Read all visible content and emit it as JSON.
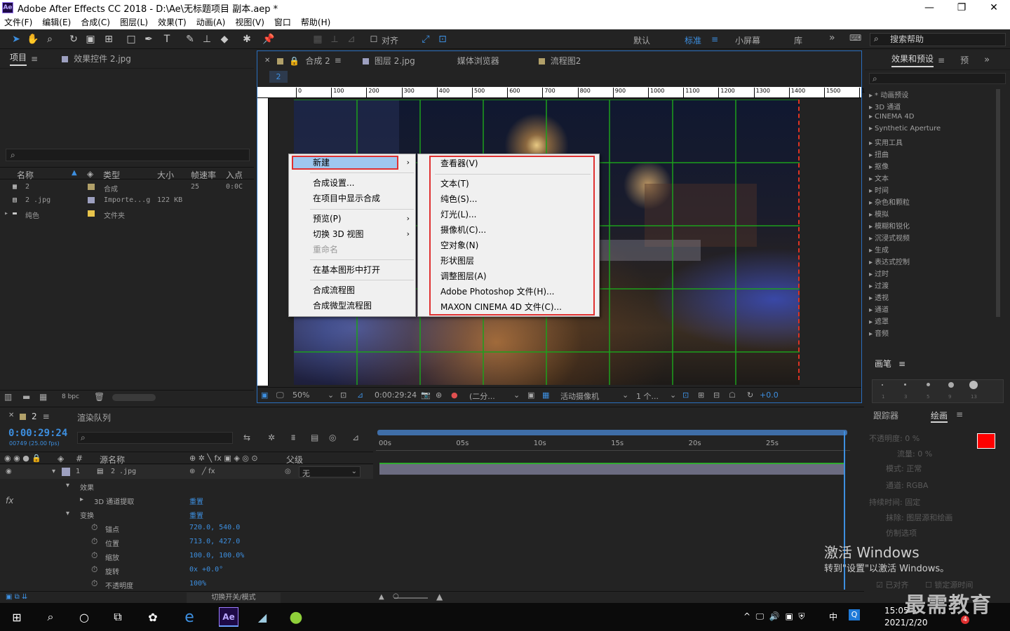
{
  "window": {
    "logo": "Ae",
    "title": "Adobe After Effects CC 2018 - D:\\Ae\\无标题项目 副本.aep *",
    "min": "—",
    "max": "❐",
    "close": "✕"
  },
  "menubar": [
    "文件(F)",
    "编辑(E)",
    "合成(C)",
    "图层(L)",
    "效果(T)",
    "动画(A)",
    "视图(V)",
    "窗口",
    "帮助(H)"
  ],
  "toolbar": {
    "align_label": "对齐",
    "workspaces": [
      "默认",
      "标准",
      "小屏幕",
      "库"
    ],
    "active_workspace": "标准",
    "more": "»",
    "search_placeholder": "搜索帮助"
  },
  "project": {
    "tabs": [
      "项目",
      "效果控件 2.jpg"
    ],
    "columns": [
      "名称",
      "类型",
      "大小",
      "帧速率",
      "入点"
    ],
    "rows": [
      {
        "name": "2",
        "type": "合成",
        "size": "",
        "fps": "25",
        "in": "0:0C",
        "color": "#b1a069"
      },
      {
        "name": "2 .jpg",
        "type": "Importe...g",
        "size": "122 KB",
        "fps": "",
        "in": "",
        "color": "#9da0c0"
      },
      {
        "name": "纯色",
        "type": "文件夹",
        "size": "",
        "fps": "",
        "in": "",
        "color": "#e8c44b"
      }
    ],
    "bpc": "8 bpc"
  },
  "comp": {
    "tabs": [
      "合成 2",
      "图层 2.jpg",
      "媒体浏览器",
      "流程图2"
    ],
    "sub_tab": "2",
    "ruler_ticks": [
      "0",
      "100",
      "200",
      "300",
      "400",
      "500",
      "600",
      "700",
      "800",
      "900",
      "1000",
      "1100",
      "1200",
      "1300",
      "1400",
      "1500",
      "16"
    ],
    "footer": {
      "zoom": "50%",
      "time": "0:00:29:24",
      "resolution": "(二分...",
      "camera": "活动摄像机",
      "views": "1 个...",
      "exposure": "+0.0"
    }
  },
  "context_menu": {
    "items": [
      {
        "label": "新建",
        "submenu": true,
        "highlight": true
      },
      {
        "label": "合成设置..."
      },
      {
        "label": "在项目中显示合成"
      },
      {
        "label": "预览(P)",
        "submenu": true
      },
      {
        "label": "切换 3D 视图",
        "submenu": true
      },
      {
        "label": "重命名",
        "disabled": true
      },
      {
        "label": "在基本图形中打开"
      },
      {
        "label": "合成流程图"
      },
      {
        "label": "合成微型流程图"
      }
    ],
    "arrow": "›"
  },
  "submenu": {
    "items": [
      "查看器(V)",
      "文本(T)",
      "纯色(S)...",
      "灯光(L)...",
      "摄像机(C)...",
      "空对象(N)",
      "形状图层",
      "调整图层(A)",
      "Adobe Photoshop 文件(H)...",
      "MAXON CINEMA 4D 文件(C)..."
    ]
  },
  "effects": {
    "tabs": [
      "效果和预设",
      "预"
    ],
    "items": [
      "* 动画预设",
      "3D 通道",
      "CINEMA 4D",
      "Synthetic Aperture",
      "实用工具",
      "扭曲",
      "抠像",
      "文本",
      "时间",
      "杂色和颗粒",
      "模拟",
      "模糊和锐化",
      "沉浸式视频",
      "生成",
      "表达式控制",
      "过时",
      "过渡",
      "透视",
      "通道",
      "遮罩",
      "音频"
    ]
  },
  "brush": {
    "tab": "画笔",
    "sizes": [
      "1",
      "3",
      "5",
      "9",
      "13"
    ]
  },
  "timeline": {
    "tabs": [
      "2",
      "渲染队列"
    ],
    "timecode": "0:00:29:24",
    "frames": "00749 (25.00 fps)",
    "columns": [
      "源名称",
      "父级"
    ],
    "ruler": [
      "00s",
      "05s",
      "10s",
      "15s",
      "20s",
      "25s"
    ],
    "layer": {
      "index": "1",
      "name": "2 .jpg",
      "parent": "无"
    },
    "props": [
      {
        "indent": 1,
        "label": "效果",
        "value": ""
      },
      {
        "indent": 2,
        "label": "3D 通道提取",
        "value": "重置",
        "fx": true
      },
      {
        "indent": 1,
        "label": "变换",
        "value": "重置"
      },
      {
        "indent": 3,
        "label": "锚点",
        "value": "720.0, 540.0"
      },
      {
        "indent": 3,
        "label": "位置",
        "value": "713.0, 427.0"
      },
      {
        "indent": 3,
        "label": "缩放",
        "value": "100.0, 100.0%"
      },
      {
        "indent": 3,
        "label": "旋转",
        "value": "0x +0.0°"
      },
      {
        "indent": 3,
        "label": "不透明度",
        "value": "100%"
      }
    ],
    "footer": "切换开关/模式"
  },
  "paint": {
    "tabs": [
      "跟踪器",
      "绘画"
    ],
    "rows": [
      "不透明度: 0 %",
      "流量: 0 %",
      "模式: 正常",
      "通道: RGBA",
      "持续时间: 固定",
      "抹除: 图层源和绘画",
      "仿制选项",
      "已对齐",
      "锁定源时间"
    ]
  },
  "activation": {
    "title": "激活 Windows",
    "hint": "转到\"设置\"以激活 Windows。"
  },
  "taskbar": {
    "time": "15:05",
    "date": "2021/2/20",
    "ime": "中",
    "badge": "4",
    "watermark": "最需教育"
  },
  "colors": {
    "accent": "#3d8fe0",
    "highlight_border": "#e03030",
    "grid": "#1ca01c",
    "paint_fg": "#ff0000"
  }
}
